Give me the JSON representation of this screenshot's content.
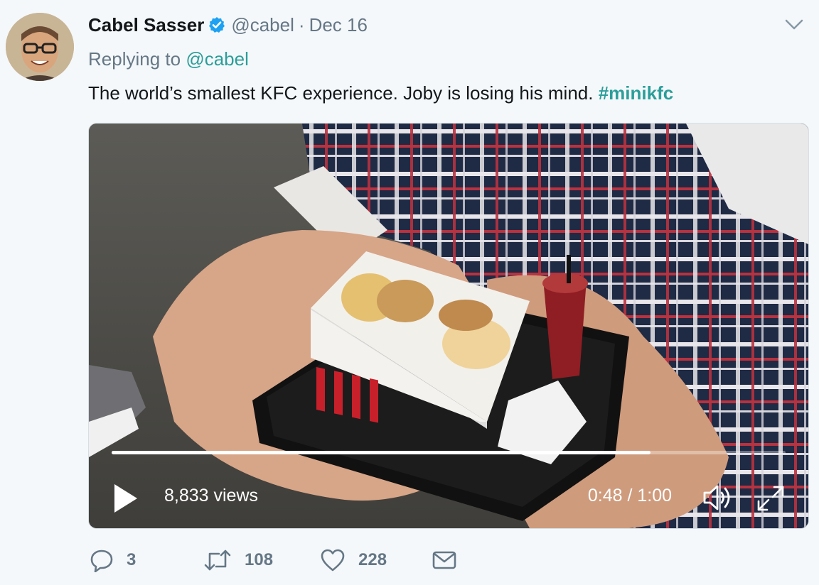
{
  "tweet": {
    "author_name": "Cabel Sasser",
    "author_handle": "@cabel",
    "separator": "·",
    "date": "Dec 16",
    "replying_prefix": "Replying to",
    "replying_handle": "@cabel",
    "text": "The world’s smallest KFC experience. Joby is losing his mind.",
    "hashtag": "#minikfc"
  },
  "video": {
    "views": "8,833 views",
    "time": "0:48 / 1:00",
    "progress_fraction": 0.8
  },
  "actions": {
    "reply_count": "3",
    "retweet_count": "108",
    "like_count": "228"
  },
  "colors": {
    "link": "#2b9e9a",
    "muted": "#657786",
    "verified": "#1da1f2",
    "background": "#f5f8fa"
  },
  "icons": [
    "verified-badge-icon",
    "chevron-down-icon",
    "play-icon",
    "volume-icon",
    "fullscreen-icon",
    "reply-icon",
    "retweet-icon",
    "like-icon",
    "message-icon"
  ]
}
